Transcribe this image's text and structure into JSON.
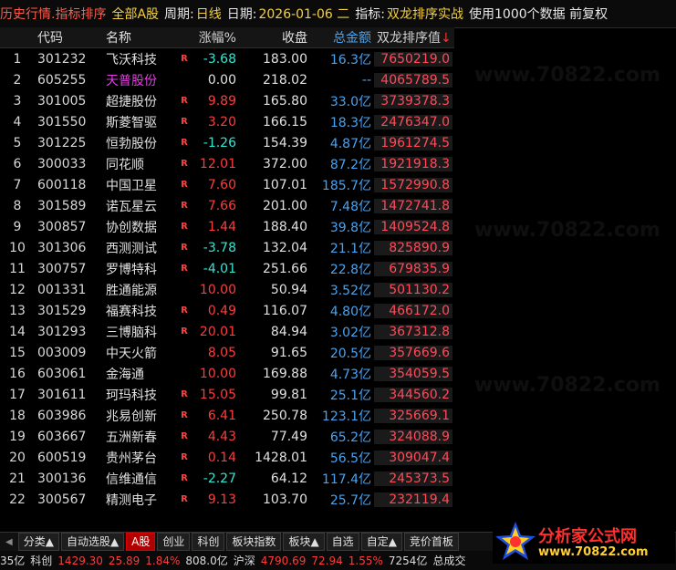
{
  "titlebar": {
    "mode": "历史行情.指标排序",
    "market": "全部A股",
    "period_label": "周期:",
    "period": "日线",
    "date_label": "日期:",
    "date": "2026-01-06 二",
    "indicator_label": "指标:",
    "indicator": "双龙排序实战",
    "data_note": "使用1000个数据 前复权"
  },
  "columns": {
    "code": "代码",
    "name": "名称",
    "change": "涨幅%",
    "close": "收盘",
    "amount": "总金额",
    "rank": "双龙排序值"
  },
  "rows": [
    {
      "idx": "1",
      "code": "301232",
      "name": "飞沃科技",
      "r": "R",
      "chg": "-3.68",
      "dir": "down",
      "close": "183.00",
      "amt": "16.3亿",
      "rank": "7650219.0"
    },
    {
      "idx": "2",
      "code": "605255",
      "name": "天普股份",
      "r": "",
      "chg": "0.00",
      "dir": "flat",
      "close": "218.02",
      "amt": "--",
      "rank": "4065789.5"
    },
    {
      "idx": "3",
      "code": "301005",
      "name": "超捷股份",
      "r": "R",
      "chg": "9.89",
      "dir": "up",
      "close": "165.80",
      "amt": "33.0亿",
      "rank": "3739378.3"
    },
    {
      "idx": "4",
      "code": "301550",
      "name": "斯菱智驱",
      "r": "R",
      "chg": "3.20",
      "dir": "up",
      "close": "166.15",
      "amt": "18.3亿",
      "rank": "2476347.0"
    },
    {
      "idx": "5",
      "code": "301225",
      "name": "恒勃股份",
      "r": "R",
      "chg": "-1.26",
      "dir": "down",
      "close": "154.39",
      "amt": "4.87亿",
      "rank": "1961274.5"
    },
    {
      "idx": "6",
      "code": "300033",
      "name": "同花顺",
      "r": "R",
      "chg": "12.01",
      "dir": "up",
      "close": "372.00",
      "amt": "87.2亿",
      "rank": "1921918.3"
    },
    {
      "idx": "7",
      "code": "600118",
      "name": "中国卫星",
      "r": "R",
      "chg": "7.60",
      "dir": "up",
      "close": "107.01",
      "amt": "185.7亿",
      "rank": "1572990.8"
    },
    {
      "idx": "8",
      "code": "301589",
      "name": "诺瓦星云",
      "r": "R",
      "chg": "7.66",
      "dir": "up",
      "close": "201.00",
      "amt": "7.48亿",
      "rank": "1472741.8"
    },
    {
      "idx": "9",
      "code": "300857",
      "name": "协创数据",
      "r": "R",
      "chg": "1.44",
      "dir": "up",
      "close": "188.40",
      "amt": "39.8亿",
      "rank": "1409524.8"
    },
    {
      "idx": "10",
      "code": "301306",
      "name": "西测测试",
      "r": "R",
      "chg": "-3.78",
      "dir": "down",
      "close": "132.04",
      "amt": "21.1亿",
      "rank": "825890.9"
    },
    {
      "idx": "11",
      "code": "300757",
      "name": "罗博特科",
      "r": "R",
      "chg": "-4.01",
      "dir": "down",
      "close": "251.66",
      "amt": "22.8亿",
      "rank": "679835.9"
    },
    {
      "idx": "12",
      "code": "001331",
      "name": "胜通能源",
      "r": "",
      "chg": "10.00",
      "dir": "up",
      "close": "50.94",
      "amt": "3.52亿",
      "rank": "501130.2"
    },
    {
      "idx": "13",
      "code": "301529",
      "name": "福赛科技",
      "r": "R",
      "chg": "0.49",
      "dir": "up",
      "close": "116.07",
      "amt": "4.80亿",
      "rank": "466172.0"
    },
    {
      "idx": "14",
      "code": "301293",
      "name": "三博脑科",
      "r": "R",
      "chg": "20.01",
      "dir": "up",
      "close": "84.94",
      "amt": "3.02亿",
      "rank": "367312.8"
    },
    {
      "idx": "15",
      "code": "003009",
      "name": "中天火箭",
      "r": "",
      "chg": "8.05",
      "dir": "up",
      "close": "91.65",
      "amt": "20.5亿",
      "rank": "357669.6"
    },
    {
      "idx": "16",
      "code": "603061",
      "name": "金海通",
      "r": "",
      "chg": "10.00",
      "dir": "up",
      "close": "169.88",
      "amt": "4.73亿",
      "rank": "354059.5"
    },
    {
      "idx": "17",
      "code": "301611",
      "name": "珂玛科技",
      "r": "R",
      "chg": "15.05",
      "dir": "up",
      "close": "99.81",
      "amt": "25.1亿",
      "rank": "344560.2"
    },
    {
      "idx": "18",
      "code": "603986",
      "name": "兆易创新",
      "r": "R",
      "chg": "6.41",
      "dir": "up",
      "close": "250.78",
      "amt": "123.1亿",
      "rank": "325669.1"
    },
    {
      "idx": "19",
      "code": "603667",
      "name": "五洲新春",
      "r": "R",
      "chg": "4.43",
      "dir": "up",
      "close": "77.49",
      "amt": "65.2亿",
      "rank": "324088.9"
    },
    {
      "idx": "20",
      "code": "600519",
      "name": "贵州茅台",
      "r": "R",
      "chg": "0.14",
      "dir": "up",
      "close": "1428.01",
      "amt": "56.5亿",
      "rank": "309047.4"
    },
    {
      "idx": "21",
      "code": "300136",
      "name": "信维通信",
      "r": "R",
      "chg": "-2.27",
      "dir": "down",
      "close": "64.12",
      "amt": "117.4亿",
      "rank": "245373.5"
    },
    {
      "idx": "22",
      "code": "300567",
      "name": "精测电子",
      "r": "R",
      "chg": "9.13",
      "dir": "up",
      "close": "103.70",
      "amt": "25.7亿",
      "rank": "232119.4"
    }
  ],
  "tabs": [
    "分类▲",
    "自动选股▲",
    "A股",
    "创业",
    "科创",
    "板块指数",
    "板块▲",
    "自选",
    "自定▲",
    "竞价首板"
  ],
  "active_tab": "A股",
  "ticker": {
    "prefix": "35亿",
    "item1_name": "科创",
    "item1_value": "1429.30",
    "item1_change": "25.89",
    "item1_pct": "1.84%",
    "item1_amount": "808.0亿",
    "item2_name": "沪深",
    "item2_value": "4790.69",
    "item2_change": "72.94",
    "item2_pct": "1.55%",
    "item2_amount": "7254亿",
    "suffix": "总成交"
  },
  "logo": {
    "main": "分析家公式网",
    "url": "www.70822.com"
  },
  "watermark": "www.70822.com"
}
